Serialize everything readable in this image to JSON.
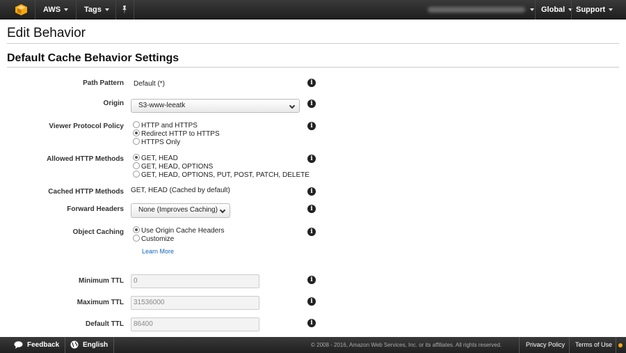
{
  "nav": {
    "logo": "aws-cube-icon",
    "aws_label": "AWS",
    "tags_label": "Tags",
    "pin_icon": "pin-icon",
    "account_blurred": true,
    "region_label": "Global",
    "support_label": "Support"
  },
  "page": {
    "title": "Edit Behavior",
    "section_title": "Default Cache Behavior Settings"
  },
  "form": {
    "path_pattern": {
      "label": "Path Pattern",
      "value": "Default (*)"
    },
    "origin": {
      "label": "Origin",
      "selected": "S3-www-leeatk"
    },
    "viewer_protocol_policy": {
      "label": "Viewer Protocol Policy",
      "options": [
        "HTTP and HTTPS",
        "Redirect HTTP to HTTPS",
        "HTTPS Only"
      ],
      "selected_index": 1
    },
    "allowed_http_methods": {
      "label": "Allowed HTTP Methods",
      "options": [
        "GET, HEAD",
        "GET, HEAD, OPTIONS",
        "GET, HEAD, OPTIONS, PUT, POST, PATCH, DELETE"
      ],
      "selected_index": 0
    },
    "cached_http_methods": {
      "label": "Cached HTTP Methods",
      "value": "GET, HEAD (Cached by default)"
    },
    "forward_headers": {
      "label": "Forward Headers",
      "selected": "None (Improves Caching)"
    },
    "object_caching": {
      "label": "Object Caching",
      "options": [
        "Use Origin Cache Headers",
        "Customize"
      ],
      "selected_index": 0,
      "learn_more": "Learn More"
    },
    "minimum_ttl": {
      "label": "Minimum TTL",
      "value": "0"
    },
    "maximum_ttl": {
      "label": "Maximum TTL",
      "value": "31536000"
    },
    "default_ttl": {
      "label": "Default TTL",
      "value": "86400"
    }
  },
  "footer": {
    "feedback_label": "Feedback",
    "english_label": "English",
    "copyright": "© 2008 - 2016, Amazon Web Services, Inc. or its affiliates. All rights reserved.",
    "privacy_label": "Privacy Policy",
    "terms_label": "Terms of Use"
  },
  "colors": {
    "nav_bg": "#232323",
    "link": "#1166bb",
    "aws_orange": "#f7a80d"
  }
}
